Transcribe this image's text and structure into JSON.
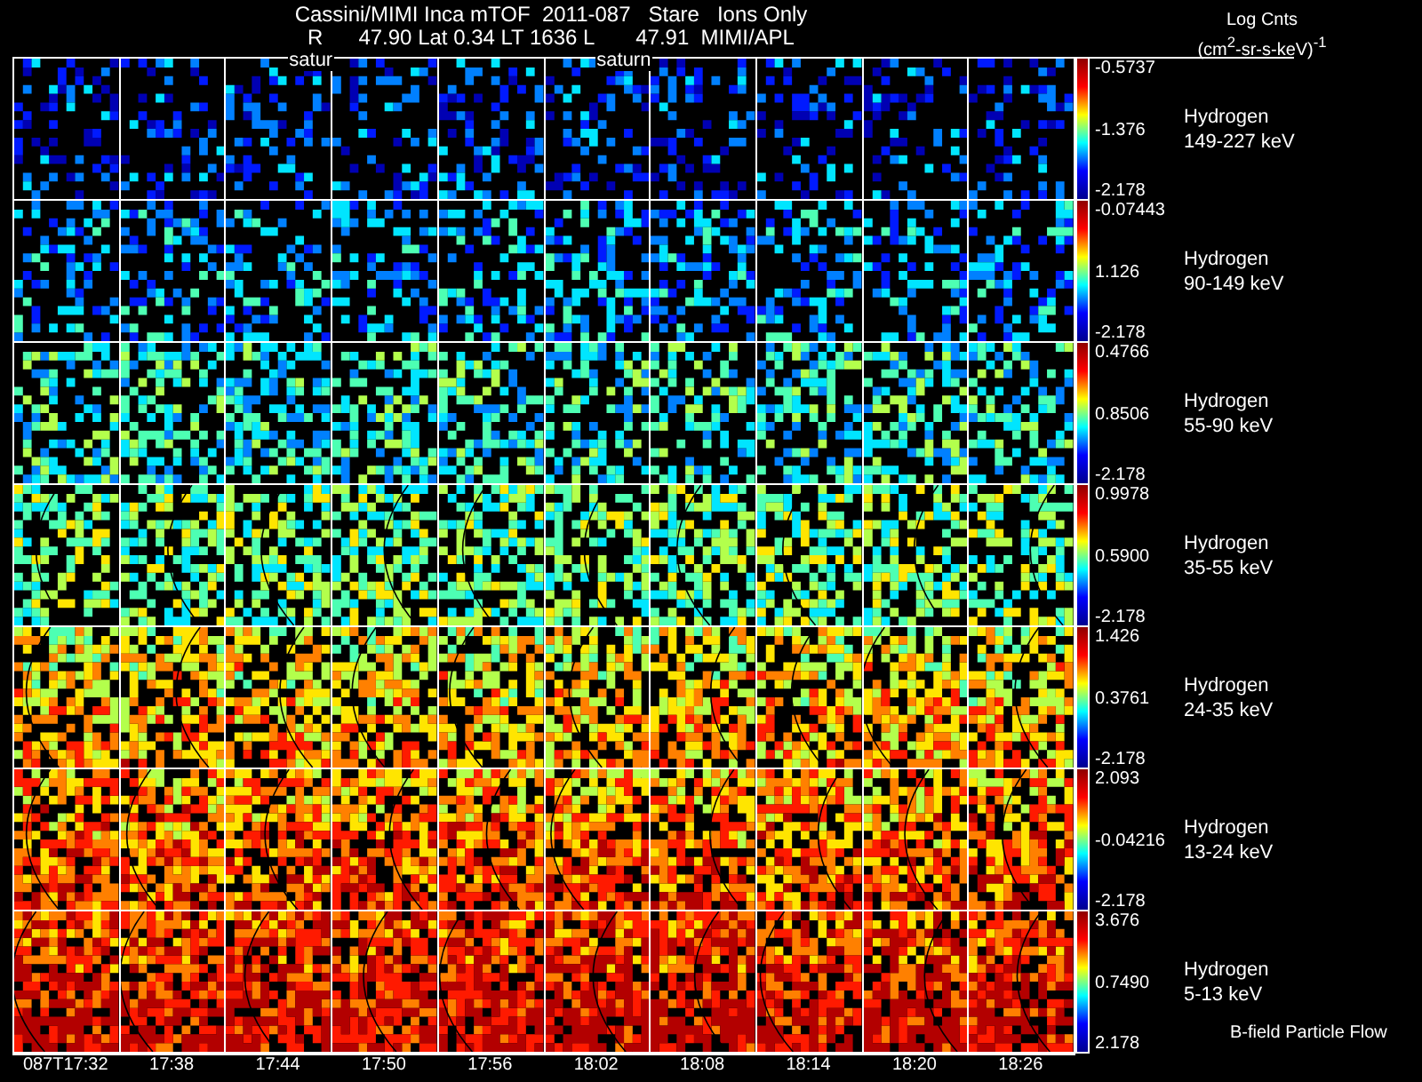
{
  "header": {
    "title": "Cassini/MIMI Inca mTOF  2011-087   Stare   Ions Only",
    "subtitle": "R      47.90 Lat 0.34 LT 1636 L       47.91  MIMI/APL"
  },
  "legend": {
    "title": "Log Cnts",
    "units": "(cm$^{2}$-sr-s-keV)$^{-1}$"
  },
  "columns": [
    {
      "time": "087T17:32"
    },
    {
      "time": "17:38"
    },
    {
      "time": "17:44",
      "planet_label": "satur"
    },
    {
      "time": "17:50"
    },
    {
      "time": "17:56"
    },
    {
      "time": "18:02",
      "planet_label": "saturn"
    },
    {
      "time": "18:08"
    },
    {
      "time": "18:14"
    },
    {
      "time": "18:20"
    },
    {
      "time": "18:26"
    }
  ],
  "rows": [
    {
      "species": "Hydrogen",
      "energy": "149-227 keV",
      "max": "-0.5737",
      "mid": "-1.376",
      "min": "-2.178"
    },
    {
      "species": "Hydrogen",
      "energy": "90-149 keV",
      "max": "-0.07443",
      "mid": "1.126",
      "min": "-2.178"
    },
    {
      "species": "Hydrogen",
      "energy": "55-90 keV",
      "max": "0.4766",
      "mid": "0.8506",
      "min": "-2.178"
    },
    {
      "species": "Hydrogen",
      "energy": "35-55 keV",
      "max": "0.9978",
      "mid": "0.5900",
      "min": "-2.178"
    },
    {
      "species": "Hydrogen",
      "energy": "24-35 keV",
      "max": "1.426",
      "mid": "0.3761",
      "min": "-2.178"
    },
    {
      "species": "Hydrogen",
      "energy": "13-24 keV",
      "max": "2.093",
      "mid": "-0.04216",
      "min": "-2.178"
    },
    {
      "species": "Hydrogen",
      "energy": "5-13 keV",
      "max": "3.676",
      "mid": "0.7490",
      "min": "2.178"
    }
  ],
  "footer_note": "B-field Particle Flow"
}
